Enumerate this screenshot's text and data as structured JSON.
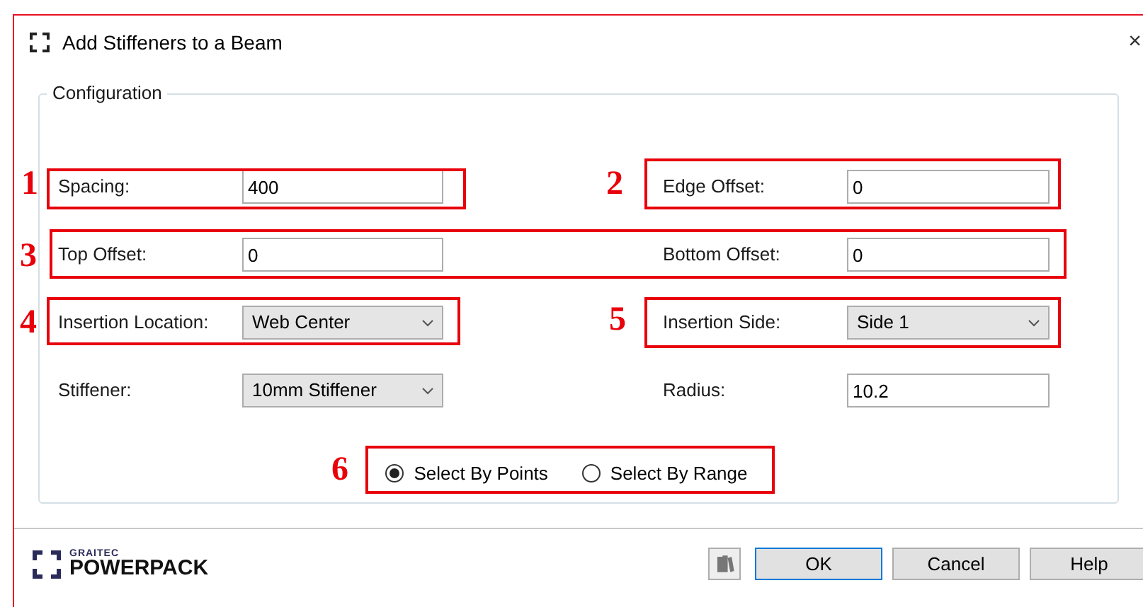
{
  "window": {
    "title": "Add Stiffeners to a Beam",
    "close": "×"
  },
  "group": {
    "title": "Configuration"
  },
  "rows": [
    [
      {
        "label": "Spacing:",
        "value": "400",
        "kind": "text"
      },
      {
        "label": "Edge Offset:",
        "value": "0",
        "kind": "text"
      }
    ],
    [
      {
        "label": "Top Offset:",
        "value": "0",
        "kind": "text"
      },
      {
        "label": "Bottom Offset:",
        "value": "0",
        "kind": "text"
      }
    ],
    [
      {
        "label": "Insertion Location:",
        "value": "Web Center",
        "kind": "dropdown"
      },
      {
        "label": "Insertion Side:",
        "value": "Side 1",
        "kind": "dropdown"
      }
    ],
    [
      {
        "label": "Stiffener:",
        "value": "10mm Stiffener",
        "kind": "dropdown"
      },
      {
        "label": "Radius:",
        "value": "10.2",
        "kind": "text"
      }
    ]
  ],
  "selection": [
    {
      "label": "Select By Points",
      "selected": true
    },
    {
      "label": "Select By Range",
      "selected": false
    }
  ],
  "logo": {
    "top": "GRAITEC",
    "bottom": "POWERPACK"
  },
  "buttons": [
    {
      "label": "OK",
      "default": true
    },
    {
      "label": "Cancel",
      "default": false
    },
    {
      "label": "Help",
      "default": false
    }
  ],
  "annotations": [
    "1",
    "2",
    "3",
    "4",
    "5",
    "6"
  ]
}
